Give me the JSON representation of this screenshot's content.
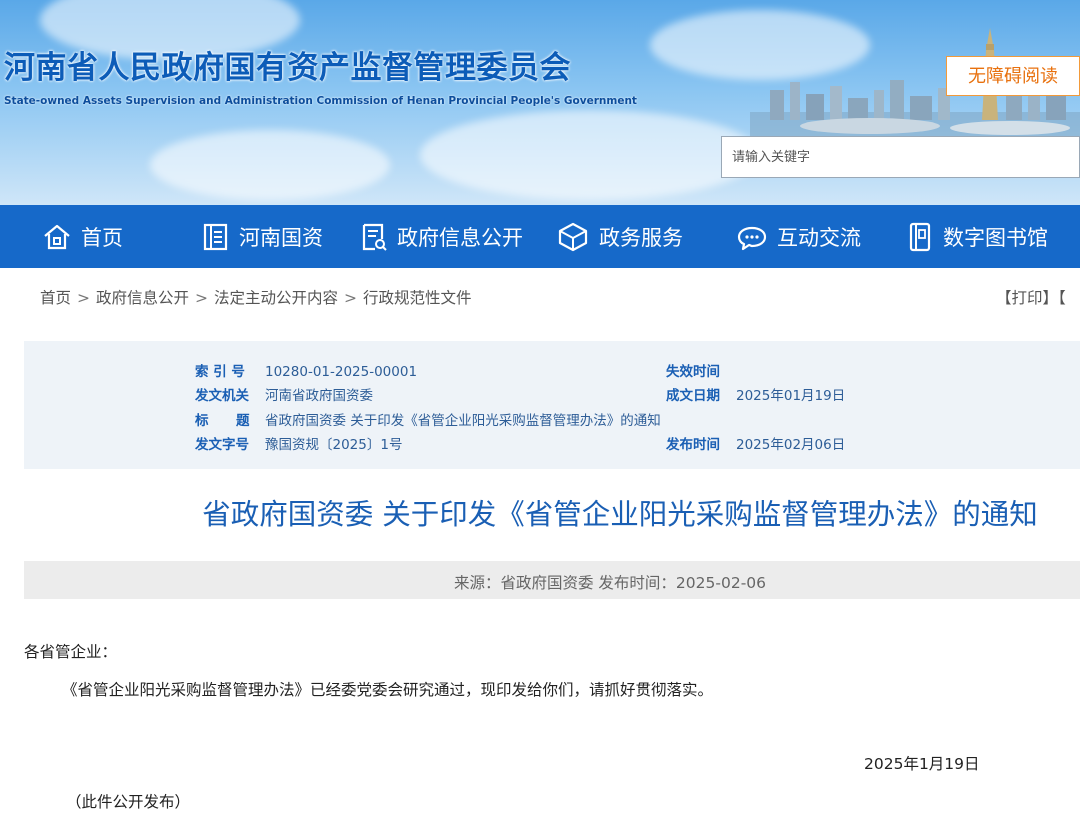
{
  "header": {
    "org_name_cn": "河南省人民政府国有资产监督管理委员会",
    "org_name_en": "State-owned Assets Supervision and Administration Commission of Henan Provincial People's Government",
    "accessibility_label": "无障碍阅读",
    "search_placeholder": "请输入关键字"
  },
  "nav": {
    "items": [
      {
        "label": "首页",
        "icon": "home-icon"
      },
      {
        "label": "河南国资",
        "icon": "list-icon"
      },
      {
        "label": "政府信息公开",
        "icon": "document-icon"
      },
      {
        "label": "政务服务",
        "icon": "cube-icon"
      },
      {
        "label": "互动交流",
        "icon": "chat-icon"
      },
      {
        "label": "数字图书馆",
        "icon": "book-icon"
      }
    ]
  },
  "breadcrumb": {
    "items": [
      "首页",
      "政府信息公开",
      "法定主动公开内容",
      "行政规范性文件"
    ],
    "separator": ">",
    "print_label": "【打印】【"
  },
  "meta": {
    "index_label": "索 引 号",
    "index_value": "10280-01-2025-00001",
    "expire_label": "失效时间",
    "expire_value": "",
    "issuer_label": "发文机关",
    "issuer_value": "河南省政府国资委",
    "created_label": "成文日期",
    "created_value": "2025年01月19日",
    "title_label_a": "标",
    "title_label_b": "题",
    "title_value": "省政府国资委 关于印发《省管企业阳光采购监督管理办法》的通知",
    "docno_label": "发文字号",
    "docno_value": "豫国资规〔2025〕1号",
    "published_label": "发布时间",
    "published_value": "2025年02月06日"
  },
  "article": {
    "title": "省政府国资委 关于印发《省管企业阳光采购监督管理办法》的通知",
    "source": "来源：省政府国资委 发布时间：2025-02-06",
    "salutation": "各省管企业：",
    "paragraph": "《省管企业阳光采购监督管理办法》已经委党委会研究通过，现印发给你们，请抓好贯彻落实。",
    "date": "2025年1月19日",
    "note": "（此件公开发布）"
  },
  "colors": {
    "nav_bg": "#1669c9",
    "title_blue": "#1a5fb4",
    "accent_orange": "#e8710e"
  }
}
